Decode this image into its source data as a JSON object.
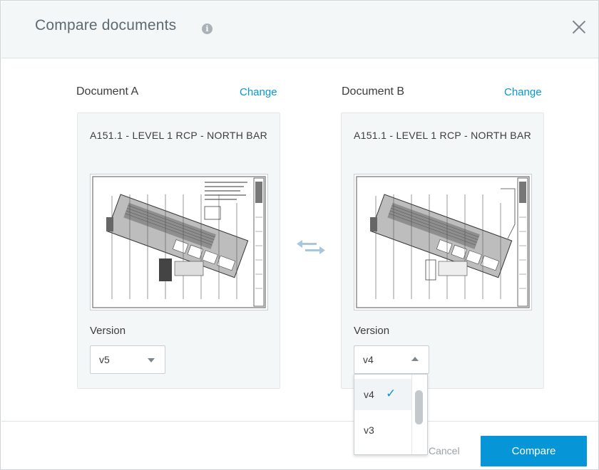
{
  "dialog": {
    "title": "Compare documents",
    "info_icon": "info-icon",
    "close_icon": "close-icon"
  },
  "doc_a": {
    "heading": "Document A",
    "change_label": "Change",
    "name": "A151.1 - LEVEL 1 RCP - NORTH BAR",
    "version_label": "Version",
    "version_value": "v5"
  },
  "doc_b": {
    "heading": "Document B",
    "change_label": "Change",
    "name": "A151.1 - LEVEL 1 RCP - NORTH BAR",
    "version_label": "Version",
    "version_value": "v4",
    "dropdown_open": true,
    "options": [
      {
        "label": "v4",
        "selected": true
      },
      {
        "label": "v3",
        "selected": false
      }
    ]
  },
  "swap_icon": "swap-arrows-icon",
  "footer": {
    "cancel_label": "Cancel",
    "compare_label": "Compare"
  },
  "colors": {
    "accent": "#0696d7",
    "header_bg": "#f4f7f8",
    "card_bg": "#f4f7f8"
  }
}
